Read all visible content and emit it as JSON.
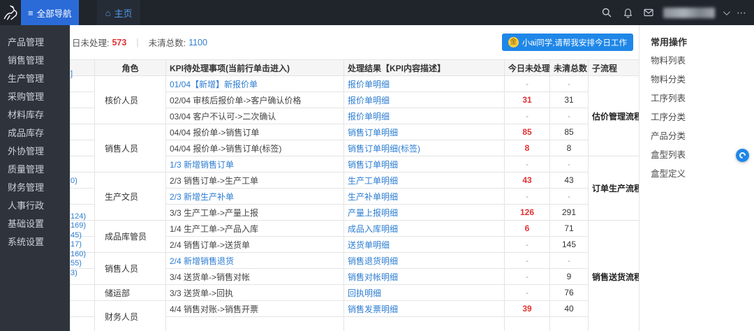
{
  "topbar": {
    "nav_icon": "≡",
    "all_nav_label": "全部导航",
    "home_icon": "⌂",
    "home_label": "主页",
    "more_label": "⋯"
  },
  "sidebar": {
    "items": [
      "产品管理",
      "销售管理",
      "生产管理",
      "采购管理",
      "材料库存",
      "成品库存",
      "外协管理",
      "质量管理",
      "财务管理",
      "人事行政",
      "基础设置",
      "系统设置"
    ]
  },
  "main": {
    "stats": {
      "unprocessed_label": "日未处理:",
      "unprocessed_value": "573",
      "divider": "|",
      "outstanding_label": "未清总数:",
      "outstanding_value": "1100"
    },
    "ai_button": {
      "icon": "金",
      "label": "小ai同学,请帮我安排今日工作"
    },
    "hidden_fragments": [
      "]",
      "0)",
      "124)",
      "169)",
      "45)",
      "17)",
      "160)",
      "55)",
      "3)"
    ],
    "table": {
      "headers": [
        "角色",
        "KPI待处理事项(当前行单击进入)",
        "处理结果【KPI内容描述】",
        "今日未处理",
        "未清总数",
        "子流程"
      ],
      "rows": [
        {
          "role": {
            "label": "核价人员",
            "span": 3
          },
          "flow": {
            "label": "估价管理流程",
            "span": 5
          },
          "kpi": "01/04【新增】新报价单",
          "kpi_link": true,
          "result": "报价单明细",
          "today": "-",
          "total": "-"
        },
        {
          "kpi": "02/04 审核后报价单->客户确认价格",
          "result": "报价单明细",
          "today": "31",
          "total": "31"
        },
        {
          "kpi": "03/04 客户不认可->二次确认",
          "result": "报价单明细",
          "today": "-",
          "total": "-"
        },
        {
          "role": {
            "label": "销售人员",
            "span": 3
          },
          "kpi": "04/04 报价单->销售订单",
          "result": "销售订单明细",
          "today": "85",
          "total": "85"
        },
        {
          "kpi": "04/04 报价单->销售订单(标签)",
          "result": "销售订单明细(标签)",
          "today": "8",
          "total": "8"
        },
        {
          "flow": {
            "label": "订单生产流程",
            "span": 4
          },
          "kpi": "1/3 新增销售订单",
          "kpi_link": true,
          "result": "销售订单明细",
          "today": "-",
          "total": "-"
        },
        {
          "role": {
            "label": "生产文员",
            "span": 3
          },
          "kpi": "2/3 销售订单->生产工单",
          "result": "生产工单明细",
          "today": "43",
          "total": "43"
        },
        {
          "kpi": "2/3 新增生产补单",
          "kpi_link": true,
          "result": "生产补单明细",
          "today": "-",
          "total": "-"
        },
        {
          "kpi": "3/3 生产工单->产量上报",
          "result": "产量上报明细",
          "today": "126",
          "total": "291"
        },
        {
          "role": {
            "label": "成品库管员",
            "span": 2
          },
          "flow": {
            "label": "销售送货流程",
            "span": 7
          },
          "kpi": "1/4 生产工单->产品入库",
          "result": "成品入库明细",
          "today": "6",
          "total": "71"
        },
        {
          "kpi": "2/4 销售订单->送货单",
          "result": "送货单明细",
          "today": "-",
          "total": "145"
        },
        {
          "role": {
            "label": "销售人员",
            "span": 2
          },
          "kpi": "2/4 新增销售退货",
          "kpi_link": true,
          "result": "销售退货明细",
          "today": "-",
          "total": "-"
        },
        {
          "kpi": "3/4 送货单->销售对帐",
          "result": "销售对帐明细",
          "today": "-",
          "total": "9"
        },
        {
          "role": {
            "label": "储运部",
            "span": 1
          },
          "kpi": "3/3 送货单->回执",
          "result": "回执明细",
          "today": "-",
          "total": "76"
        },
        {
          "role": {
            "label": "财务人员",
            "span": 2
          },
          "kpi": "4/4 销售对账->销售开票",
          "result": "销售发票明细",
          "today": "39",
          "total": "40"
        },
        {
          "kpi": "",
          "result": "",
          "today": "",
          "total": ""
        }
      ]
    }
  },
  "right_panel": {
    "title": "常用操作",
    "items": [
      "物料列表",
      "物料分类",
      "工序列表",
      "工序分类",
      "产品分类",
      "盒型列表",
      "盒型定义"
    ]
  },
  "colors": {
    "accent_blue": "#2a6bd8",
    "ai_blue": "#1f87e8",
    "link_blue": "#2d7dd2",
    "danger_red": "#e03131"
  }
}
